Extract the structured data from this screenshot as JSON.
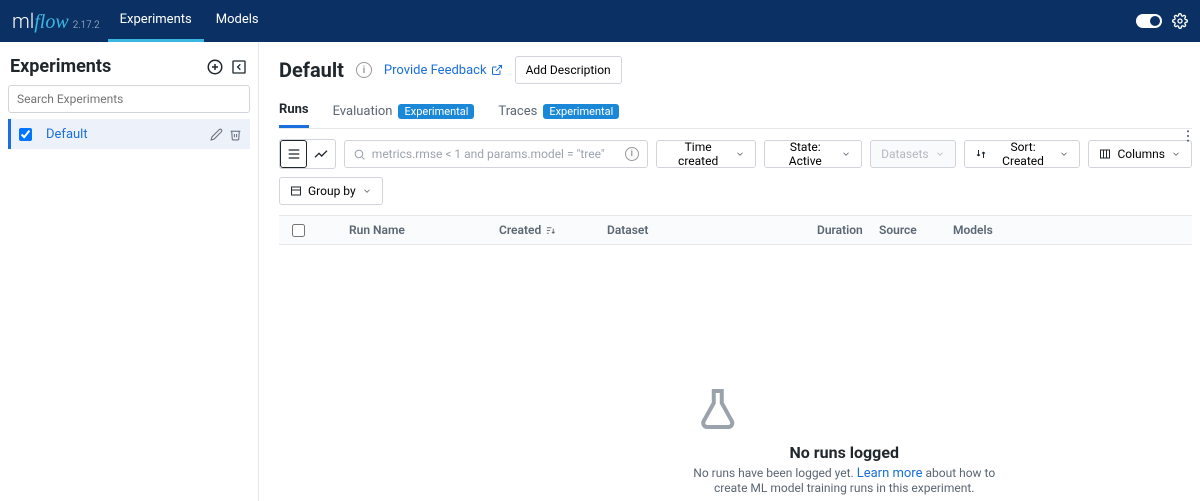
{
  "brand": {
    "ml": "ml",
    "flow": "flow",
    "version": "2.17.2"
  },
  "nav": {
    "experiments": "Experiments",
    "models": "Models"
  },
  "sidebar": {
    "title": "Experiments",
    "search_placeholder": "Search Experiments",
    "items": [
      {
        "label": "Default",
        "checked": true
      }
    ]
  },
  "page": {
    "title": "Default",
    "feedback": "Provide Feedback",
    "add_description": "Add Description"
  },
  "tabs": {
    "runs": "Runs",
    "evaluation": "Evaluation",
    "traces": "Traces",
    "exp_badge": "Experimental"
  },
  "toolbar": {
    "search_placeholder": "metrics.rmse < 1 and params.model = \"tree\"",
    "time_created": "Time created",
    "state": "State: Active",
    "datasets": "Datasets",
    "sort": "Sort: Created",
    "columns": "Columns",
    "group_by": "Group by"
  },
  "thead": {
    "name": "Run Name",
    "created": "Created",
    "dataset": "Dataset",
    "duration": "Duration",
    "source": "Source",
    "models": "Models"
  },
  "empty": {
    "title": "No runs logged",
    "pre": "No runs have been logged yet. ",
    "link": "Learn more",
    "post": " about how to",
    "line2": "create ML model training runs in this experiment."
  }
}
